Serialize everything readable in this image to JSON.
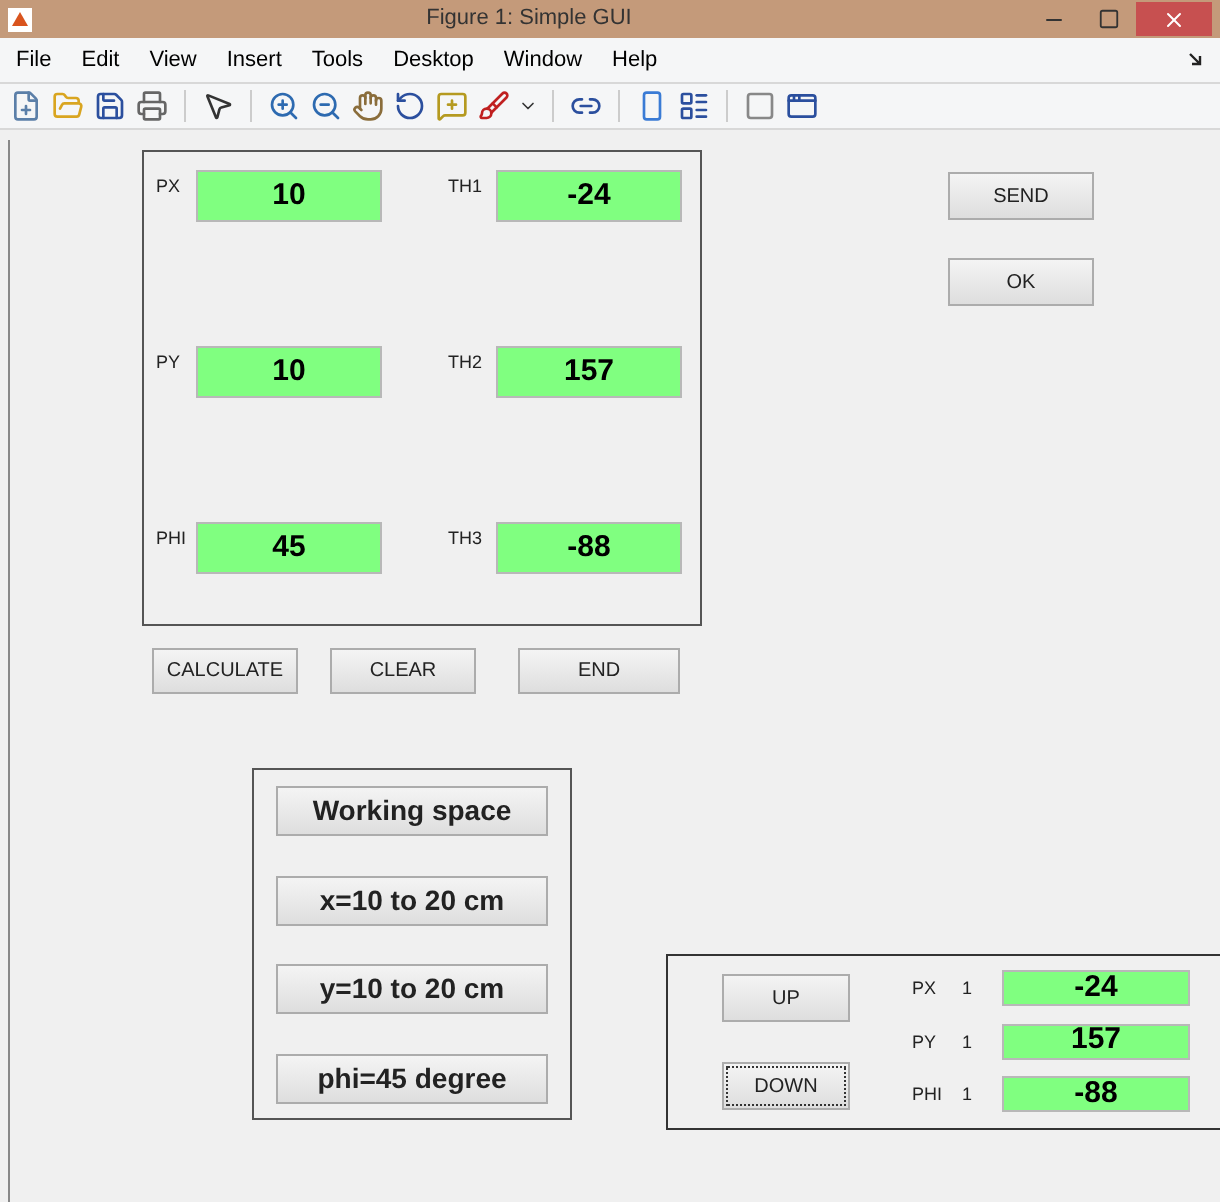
{
  "window": {
    "title": "Figure 1: Simple GUI"
  },
  "menu": [
    "File",
    "Edit",
    "View",
    "Insert",
    "Tools",
    "Desktop",
    "Window",
    "Help"
  ],
  "input_panel": {
    "fields": [
      {
        "label": "PX",
        "value": "10"
      },
      {
        "label": "TH1",
        "value": "-24"
      },
      {
        "label": "PY",
        "value": "10"
      },
      {
        "label": "TH2",
        "value": "157"
      },
      {
        "label": "PHI",
        "value": "45"
      },
      {
        "label": "TH3",
        "value": "-88"
      }
    ]
  },
  "action_buttons": [
    "CALCULATE",
    "CLEAR",
    "END"
  ],
  "side_buttons": [
    "SEND",
    "OK"
  ],
  "working_space": [
    "Working space",
    "x=10 to 20 cm",
    "y=10 to 20 cm",
    "phi=45 degree"
  ],
  "jog_panel": {
    "buttons": [
      {
        "label": "UP",
        "focused": false
      },
      {
        "label": "DOWN",
        "focused": true
      }
    ],
    "readouts": [
      {
        "label": "PX",
        "step": "1",
        "value": "-24"
      },
      {
        "label": "PY",
        "step": "1",
        "value": "157"
      },
      {
        "label": "PHI",
        "step": "1",
        "value": "-88"
      }
    ]
  }
}
